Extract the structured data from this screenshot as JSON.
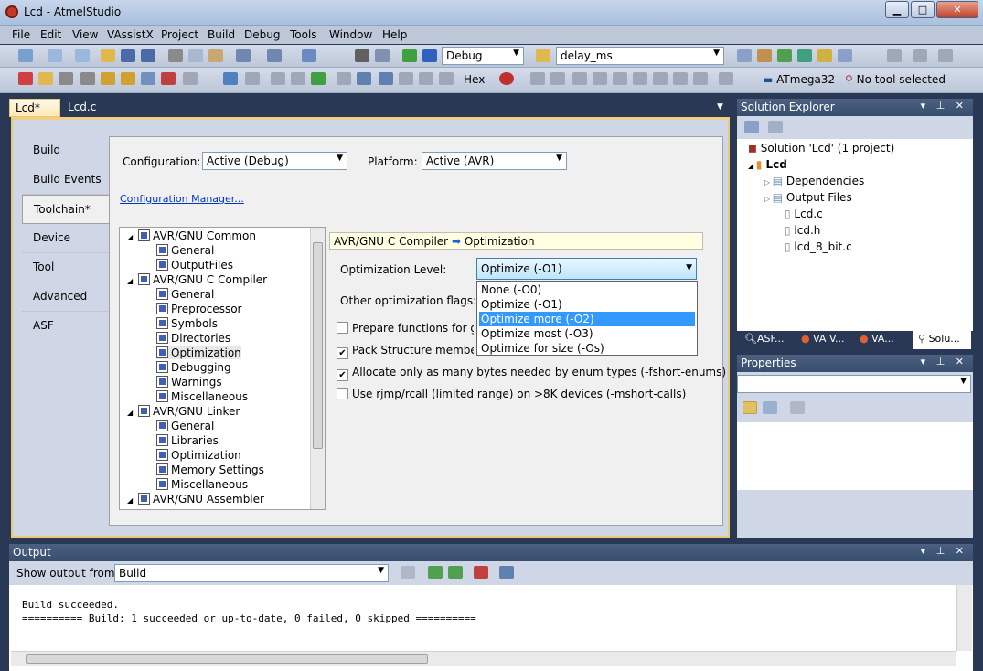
{
  "window": {
    "title": "Lcd - AtmelStudio"
  },
  "menu": [
    "File",
    "Edit",
    "View",
    "VAssistX",
    "Project",
    "Build",
    "Debug",
    "Tools",
    "Window",
    "Help"
  ],
  "toolbar": {
    "config_value": "Debug",
    "find_value": "delay_ms",
    "hex_label": "Hex",
    "device_label": "ATmega32",
    "tool_label": "No tool selected"
  },
  "tabs": [
    {
      "label": "Lcd*"
    },
    {
      "label": "Lcd.c"
    }
  ],
  "vtabs": [
    "Build",
    "Build Events",
    "Toolchain*",
    "Device",
    "Tool",
    "Advanced",
    "ASF"
  ],
  "props": {
    "config_label": "Configuration:",
    "config_value": "Active (Debug)",
    "platform_label": "Platform:",
    "platform_value": "Active (AVR)",
    "config_manager": "Configuration Manager..."
  },
  "tree": {
    "items": [
      {
        "label": "AVR/GNU Common",
        "level": 0
      },
      {
        "label": "General",
        "level": 1
      },
      {
        "label": "OutputFiles",
        "level": 1
      },
      {
        "label": "AVR/GNU C Compiler",
        "level": 0
      },
      {
        "label": "General",
        "level": 1
      },
      {
        "label": "Preprocessor",
        "level": 1
      },
      {
        "label": "Symbols",
        "level": 1
      },
      {
        "label": "Directories",
        "level": 1
      },
      {
        "label": "Optimization",
        "level": 1
      },
      {
        "label": "Debugging",
        "level": 1
      },
      {
        "label": "Warnings",
        "level": 1
      },
      {
        "label": "Miscellaneous",
        "level": 1
      },
      {
        "label": "AVR/GNU Linker",
        "level": 0
      },
      {
        "label": "General",
        "level": 1
      },
      {
        "label": "Libraries",
        "level": 1
      },
      {
        "label": "Optimization",
        "level": 1
      },
      {
        "label": "Memory Settings",
        "level": 1
      },
      {
        "label": "Miscellaneous",
        "level": 1
      },
      {
        "label": "AVR/GNU Assembler",
        "level": 0
      }
    ]
  },
  "section": {
    "title_a": "AVR/GNU C Compiler",
    "title_b": "Optimization"
  },
  "optimization": {
    "level_label": "Optimization Level:",
    "level_value": "Optimize (-O1)",
    "other_label": "Other optimization flags:",
    "options": [
      "None (-O0)",
      "Optimize (-O1)",
      "Optimize more (-O2)",
      "Optimize most (-O3)",
      "Optimize for size (-Os)"
    ],
    "checks": [
      {
        "label": "Prepare functions for garb",
        "checked": false
      },
      {
        "label": "Pack Structure members t",
        "checked": true
      },
      {
        "label": "Allocate only as many bytes needed by enum types (-fshort-enums)",
        "checked": true
      },
      {
        "label": "Use rjmp/rcall (limited range) on >8K devices (-mshort-calls)",
        "checked": false
      }
    ]
  },
  "solution": {
    "title": "Solution Explorer",
    "solution_label": "Solution 'Lcd' (1 project)",
    "project": "Lcd",
    "items": [
      "Dependencies",
      "Output Files",
      "Lcd.c",
      "lcd.h",
      "lcd_8_bit.c"
    ],
    "bottom_tabs": [
      "ASF...",
      "VA V...",
      "VA...",
      "Solu..."
    ]
  },
  "properties": {
    "title": "Properties"
  },
  "output": {
    "title": "Output",
    "show_label": "Show output from:",
    "source": "Build",
    "line1": "Build succeeded.",
    "line2": "========== Build: 1 succeeded or up-to-date, 0 failed, 0 skipped =========="
  }
}
